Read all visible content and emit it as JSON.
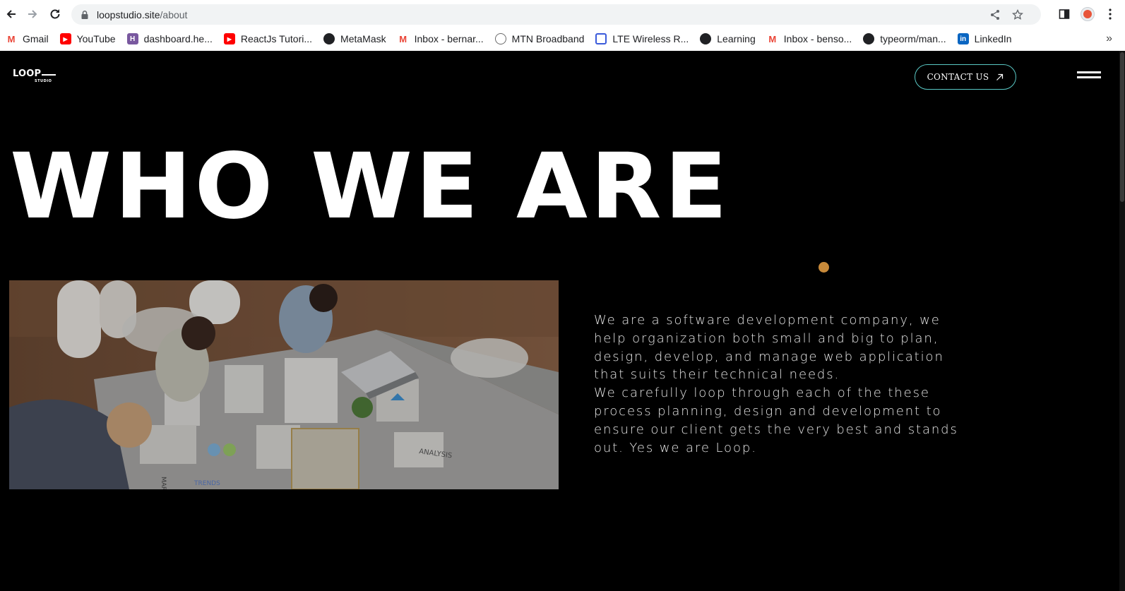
{
  "browser": {
    "url_host": "loopstudio.site",
    "url_path": "/about",
    "bookmarks": [
      {
        "label": "Gmail",
        "icon": "gmail-icon",
        "color": "#ea4335"
      },
      {
        "label": "YouTube",
        "icon": "youtube-icon",
        "color": "#ff0000"
      },
      {
        "label": "dashboard.he...",
        "icon": "heroku-icon",
        "color": "#79589f"
      },
      {
        "label": "ReactJs Tutori...",
        "icon": "youtube-icon",
        "color": "#ff0000"
      },
      {
        "label": "MetaMask",
        "icon": "globe-icon",
        "color": "#202124"
      },
      {
        "label": "Inbox - bernar...",
        "icon": "gmail-icon",
        "color": "#ea4335"
      },
      {
        "label": "MTN Broadband",
        "icon": "mtn-icon",
        "color": "#6b6b6b"
      },
      {
        "label": "LTE Wireless R...",
        "icon": "router-icon",
        "color": "#3b5bdb"
      },
      {
        "label": "Learning",
        "icon": "globe-icon",
        "color": "#202124"
      },
      {
        "label": "Inbox - benso...",
        "icon": "gmail-icon",
        "color": "#ea4335"
      },
      {
        "label": "typeorm/man...",
        "icon": "github-icon",
        "color": "#202124"
      },
      {
        "label": "LinkedIn",
        "icon": "linkedin-icon",
        "color": "#0a66c2"
      }
    ],
    "more_label": "»"
  },
  "site": {
    "logo": {
      "word": "LOOP",
      "sub": "STUDIO"
    },
    "contact_label": "CONTACT US",
    "accent_color": "#59c7c4",
    "dot_color": "#c88a3a"
  },
  "hero": {
    "title": "WHO WE ARE"
  },
  "about": {
    "paragraph_1": "We are a software development company, we help organization both small and big to plan, design, develop, and manage web application that suits their technical needs.",
    "paragraph_2": "We carefully loop through each of the these process planning, design and development to ensure our client gets the very best and stands out. Yes we are Loop."
  },
  "photo": {
    "printed_text": [
      "ANALYSIS",
      "TRENDS",
      "MAR STR"
    ]
  }
}
